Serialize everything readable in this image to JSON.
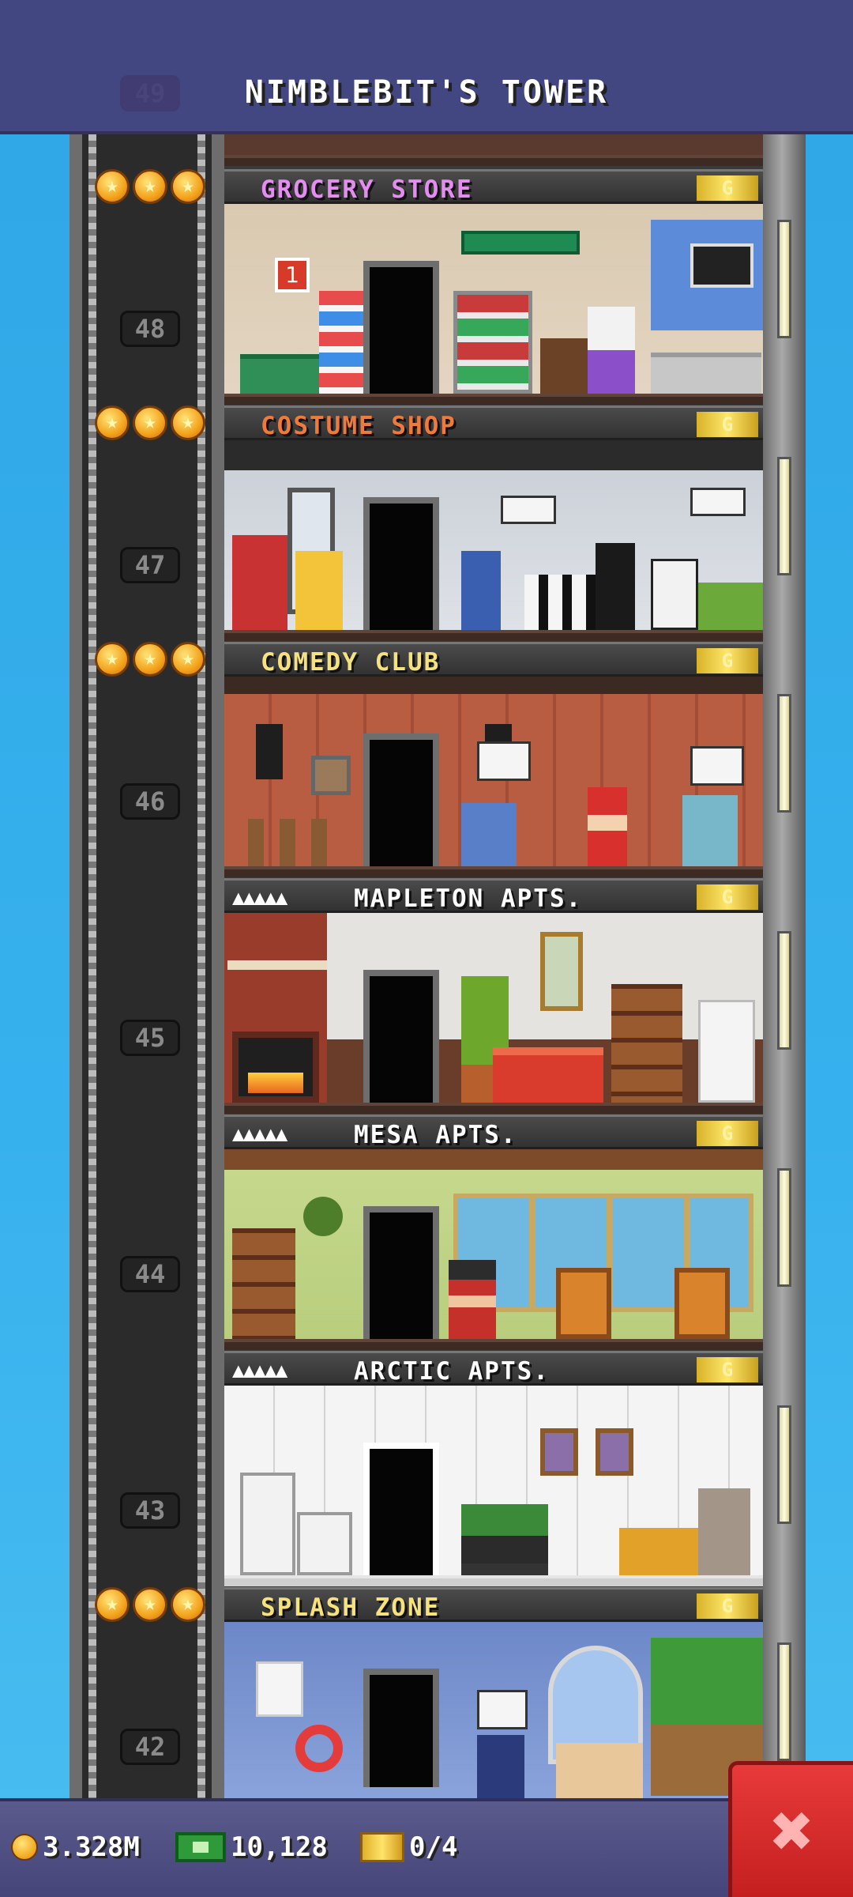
{
  "header": {
    "title": "NIMBLEBIT'S TOWER"
  },
  "floors": [
    {
      "number": "49",
      "name": "GROCERY STORE",
      "kind": "business",
      "color": "#e58cf0"
    },
    {
      "number": "48",
      "name": "COSTUME SHOP",
      "kind": "business",
      "color": "#f07a3a"
    },
    {
      "number": "47",
      "name": "COMEDY CLUB",
      "kind": "business",
      "color": "#f5e27a"
    },
    {
      "number": "46",
      "name": "MAPLETON APTS.",
      "kind": "residential",
      "color": "#ffffff"
    },
    {
      "number": "45",
      "name": "MESA APTS.",
      "kind": "residential",
      "color": "#ffffff"
    },
    {
      "number": "44",
      "name": "ARCTIC APTS.",
      "kind": "residential",
      "color": "#ffffff"
    },
    {
      "number": "43",
      "name": "SPLASH ZONE",
      "kind": "business",
      "color": "#f5e27a"
    },
    {
      "number": "42",
      "name": "",
      "kind": "partial",
      "color": "#ffffff"
    }
  ],
  "floor_badge": "G",
  "resident_marks": "▲▲▲▲▲",
  "star_glyph": "★",
  "room_sign": "1",
  "stats": {
    "coins": "3.328M",
    "bux": "10,128",
    "tickets": "0/4"
  },
  "close_label": "✖"
}
